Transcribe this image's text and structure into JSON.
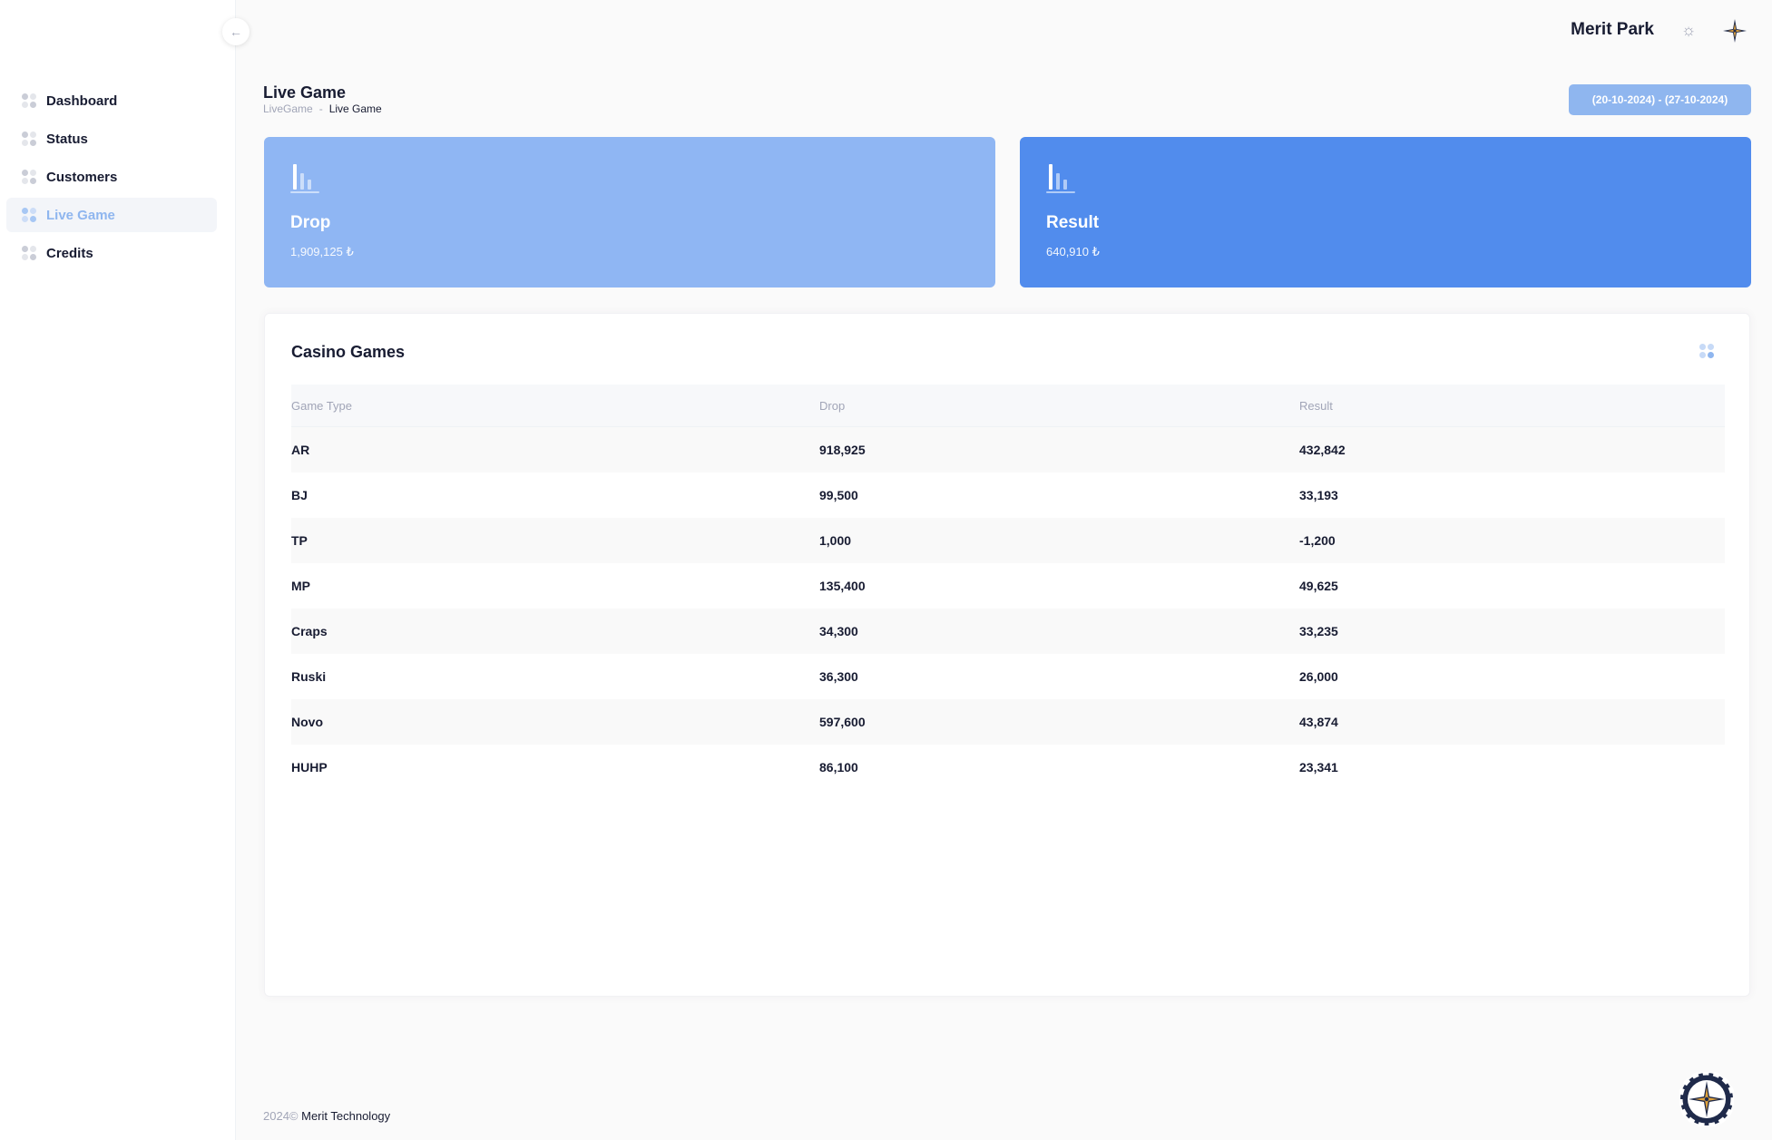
{
  "sidebar": {
    "toggle_icon": "arrow-left-icon",
    "items": [
      {
        "label": "Dashboard",
        "active": false
      },
      {
        "label": "Status",
        "active": false
      },
      {
        "label": "Customers",
        "active": false
      },
      {
        "label": "Live Game",
        "active": true
      },
      {
        "label": "Credits",
        "active": false
      }
    ]
  },
  "header": {
    "brand": "Merit Park",
    "theme_icon": "sun-icon"
  },
  "page": {
    "title": "Live Game",
    "breadcrumb": [
      "LiveGame",
      "-",
      "Live Game"
    ],
    "date_range": "(20-10-2024) - (27-10-2024)"
  },
  "cards": {
    "drop": {
      "title": "Drop",
      "value": "1,909,125 ₺",
      "color": "#8fb6f3"
    },
    "result": {
      "title": "Result",
      "value": "640,910 ₺",
      "color": "#518ced"
    }
  },
  "table": {
    "title": "Casino Games",
    "columns": [
      "Game Type",
      "Drop",
      "Result"
    ],
    "rows": [
      [
        "AR",
        "918,925",
        "432,842"
      ],
      [
        "BJ",
        "99,500",
        "33,193"
      ],
      [
        "TP",
        "1,000",
        "-1,200"
      ],
      [
        "MP",
        "135,400",
        "49,625"
      ],
      [
        "Craps",
        "34,300",
        "33,235"
      ],
      [
        "Ruski",
        "36,300",
        "26,000"
      ],
      [
        "Novo",
        "597,600",
        "43,874"
      ],
      [
        "HUHP",
        "86,100",
        "23,341"
      ]
    ]
  },
  "footer": {
    "year": "2024©",
    "company": "Merit Technology"
  },
  "colors": {
    "accent": "#8fb6ef",
    "primary": "#518ced"
  }
}
